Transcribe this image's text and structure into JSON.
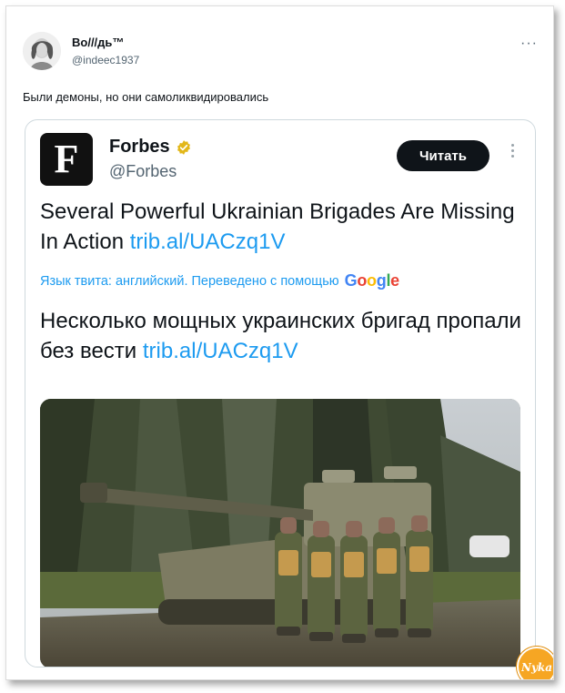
{
  "tweet": {
    "author_name": "Во///дь™",
    "author_handle": "@indeec1937",
    "text": "Были демоны, но они самоликвидировались"
  },
  "quoted": {
    "logo_letter": "F",
    "name": "Forbes",
    "handle": "@Forbes",
    "follow_label": "Читать",
    "headline_en": "Several Powerful Ukrainian Brigades Are Missing In Action",
    "link": "trib.al/UACzq1V",
    "translation_note": "Язык твита: английский. Переведено с помощью",
    "google_text": "Google",
    "headline_ru": "Несколько мощных украинских бригад пропали без вести",
    "verified_icon": "verified-badge-icon",
    "more_icon": "more-vertical-icon"
  },
  "colors": {
    "link": "#1d9bf0",
    "text": "#0f1419",
    "muted": "#536471",
    "verified_badge": "#e2b719",
    "button_bg": "#0f1419",
    "watermark": "#f6a623"
  },
  "watermark": {
    "text": "Nyka"
  }
}
